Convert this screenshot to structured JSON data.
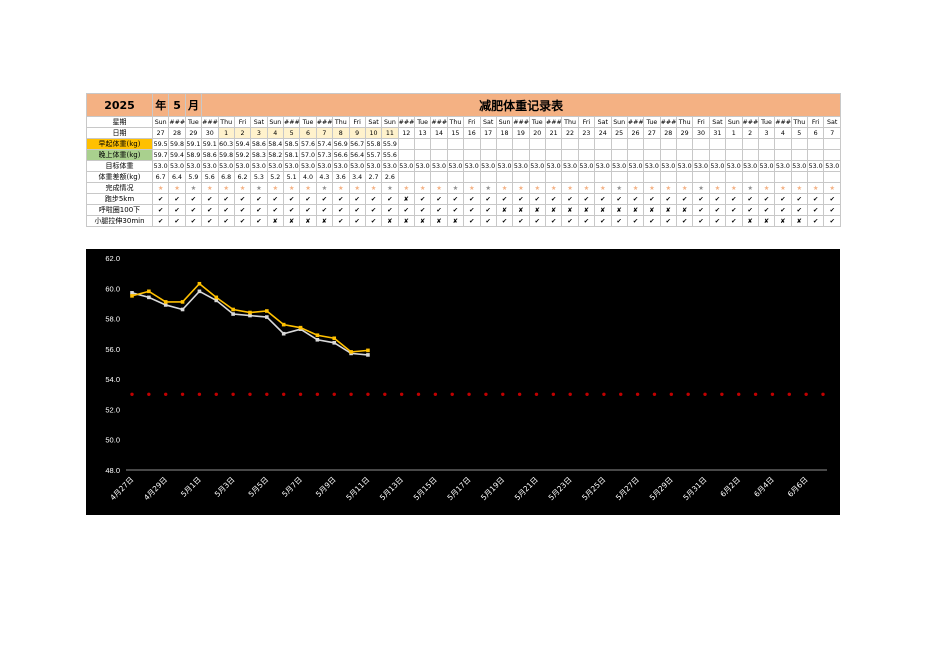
{
  "header": {
    "year": "2025",
    "year_unit": "年",
    "month": "5",
    "month_unit": "月",
    "title": "减肥体重记录表"
  },
  "rows": {
    "weekday_label": "星期",
    "date_label": "日期",
    "morning_label": "早起体重(kg)",
    "evening_label": "晚上体重(kg)",
    "target_label": "目标体重",
    "gap_label": "体重差额(kg)",
    "status_label": "完成情况",
    "run_label": "跑步5km",
    "squat_label": "呼啦圈100下",
    "stretch_label": "小腿拉伸30min"
  },
  "weekdays": [
    "Sun",
    "###",
    "Tue",
    "###",
    "Thu",
    "Fri",
    "Sat",
    "Sun",
    "###",
    "Tue",
    "###",
    "Thu",
    "Fri",
    "Sat",
    "Sun",
    "###",
    "Tue",
    "###",
    "Thu",
    "Fri",
    "Sat",
    "Sun",
    "###",
    "Tue",
    "###",
    "Thu",
    "Fri",
    "Sat",
    "Sun",
    "###",
    "Tue",
    "###",
    "Thu",
    "Fri",
    "Sat",
    "Sun",
    "###",
    "Tue",
    "###",
    "Thu",
    "Fri",
    "Sat"
  ],
  "dates": [
    "27",
    "28",
    "29",
    "30",
    "1",
    "2",
    "3",
    "4",
    "5",
    "6",
    "7",
    "8",
    "9",
    "10",
    "11",
    "12",
    "13",
    "14",
    "15",
    "16",
    "17",
    "18",
    "19",
    "20",
    "21",
    "22",
    "23",
    "24",
    "25",
    "26",
    "27",
    "28",
    "29",
    "30",
    "31",
    "1",
    "2",
    "3",
    "4",
    "5",
    "6",
    "7"
  ],
  "morning": [
    "59.5",
    "59.8",
    "59.1",
    "59.1",
    "60.3",
    "59.4",
    "58.6",
    "58.4",
    "58.5",
    "57.6",
    "57.4",
    "56.9",
    "56.7",
    "55.8",
    "55.9",
    "",
    "",
    "",
    "",
    "",
    "",
    "",
    "",
    "",
    "",
    "",
    "",
    "",
    "",
    "",
    "",
    "",
    "",
    "",
    "",
    "",
    "",
    "",
    "",
    "",
    "",
    ""
  ],
  "evening": [
    "59.7",
    "59.4",
    "58.9",
    "58.6",
    "59.8",
    "59.2",
    "58.3",
    "58.2",
    "58.1",
    "57.0",
    "57.3",
    "56.6",
    "56.4",
    "55.7",
    "55.6",
    "",
    "",
    "",
    "",
    "",
    "",
    "",
    "",
    "",
    "",
    "",
    "",
    "",
    "",
    "",
    "",
    "",
    "",
    "",
    "",
    "",
    "",
    "",
    "",
    "",
    "",
    ""
  ],
  "target": [
    "53.0",
    "53.0",
    "53.0",
    "53.0",
    "53.0",
    "53.0",
    "53.0",
    "53.0",
    "53.0",
    "53.0",
    "53.0",
    "53.0",
    "53.0",
    "53.0",
    "53.0",
    "53.0",
    "53.0",
    "53.0",
    "53.0",
    "53.0",
    "53.0",
    "53.0",
    "53.0",
    "53.0",
    "53.0",
    "53.0",
    "53.0",
    "53.0",
    "53.0",
    "53.0",
    "53.0",
    "53.0",
    "53.0",
    "53.0",
    "53.0",
    "53.0",
    "53.0",
    "53.0",
    "53.0",
    "53.0",
    "53.0",
    "53.0"
  ],
  "gap": [
    "6.7",
    "6.4",
    "5.9",
    "5.6",
    "6.8",
    "6.2",
    "5.3",
    "5.2",
    "5.1",
    "4.0",
    "4.3",
    "3.6",
    "3.4",
    "2.7",
    "2.6",
    "",
    "",
    "",
    "",
    "",
    "",
    "",
    "",
    "",
    "",
    "",
    "",
    "",
    "",
    "",
    "",
    "",
    "",
    "",
    "",
    "",
    "",
    "",
    "",
    "",
    "",
    ""
  ],
  "status_stars": [
    "g",
    "g",
    "s",
    "g",
    "g",
    "g",
    "s",
    "g",
    "g",
    "g",
    "s",
    "g",
    "g",
    "g",
    "s",
    "g",
    "g",
    "g",
    "s",
    "g",
    "s",
    "g",
    "g",
    "g",
    "g",
    "g",
    "g",
    "g",
    "s",
    "g",
    "g",
    "g",
    "g",
    "s",
    "g",
    "g",
    "s",
    "g",
    "g",
    "g",
    "g",
    "g"
  ],
  "run": [
    "✔",
    "✔",
    "✔",
    "✔",
    "✔",
    "✔",
    "✔",
    "✔",
    "✔",
    "✔",
    "✔",
    "✔",
    "✔",
    "✔",
    "✔",
    "✘",
    "✔",
    "✔",
    "✔",
    "✔",
    "✔",
    "✔",
    "✔",
    "✔",
    "✔",
    "✔",
    "✔",
    "✔",
    "✔",
    "✔",
    "✔",
    "✔",
    "✔",
    "✔",
    "✔",
    "✔",
    "✔",
    "✔",
    "✔",
    "✔",
    "✔",
    "✔"
  ],
  "squat": [
    "✔",
    "✔",
    "✔",
    "✔",
    "✔",
    "✔",
    "✔",
    "✔",
    "✔",
    "✔",
    "✔",
    "✔",
    "✔",
    "✔",
    "✔",
    "✔",
    "✔",
    "✔",
    "✔",
    "✔",
    "✔",
    "✘",
    "✘",
    "✘",
    "✘",
    "✘",
    "✘",
    "✘",
    "✘",
    "✘",
    "✘",
    "✘",
    "✘",
    "✔",
    "✔",
    "✔",
    "✔",
    "✔",
    "✔",
    "✔",
    "✔",
    "✔"
  ],
  "stretch": [
    "✔",
    "✔",
    "✔",
    "✔",
    "✔",
    "✔",
    "✔",
    "✘",
    "✘",
    "✘",
    "✘",
    "✔",
    "✔",
    "✔",
    "✘",
    "✘",
    "✘",
    "✘",
    "✘",
    "✔",
    "✔",
    "✔",
    "✔",
    "✔",
    "✔",
    "✔",
    "✔",
    "✔",
    "✔",
    "✔",
    "✔",
    "✔",
    "✔",
    "✔",
    "✔",
    "✔",
    "✘",
    "✘",
    "✘",
    "✘",
    "✔",
    "✔"
  ],
  "colors": {
    "header_fill": "#f4b183",
    "morning_fill": "#ffc000",
    "evening_fill": "#a9d08e",
    "chart_bg": "#000000",
    "line_morning": "#ffc000",
    "line_evening": "#d9d9d9",
    "line_target": "#c00000"
  },
  "chart_data": {
    "type": "line",
    "title": "",
    "xlabel": "",
    "ylabel": "",
    "ylim": [
      48,
      62
    ],
    "yticks": [
      "48.0",
      "50.0",
      "52.0",
      "54.0",
      "56.0",
      "58.0",
      "60.0",
      "62.0"
    ],
    "xtick_labels": [
      "4月27日",
      "4月29日",
      "5月1日",
      "5月3日",
      "5月5日",
      "5月7日",
      "5月9日",
      "5月11日",
      "5月13日",
      "5月15日",
      "5月17日",
      "5月19日",
      "5月21日",
      "5月23日",
      "5月25日",
      "5月27日",
      "5月29日",
      "5月31日",
      "6月2日",
      "6月4日",
      "6月6日"
    ],
    "grid": false,
    "legend": "none",
    "series": [
      {
        "values": [
          59.5,
          59.8,
          59.1,
          59.1,
          60.3,
          59.4,
          58.6,
          58.4,
          58.5,
          57.6,
          57.4,
          56.9,
          56.7,
          55.8,
          55.9
        ]
      },
      {
        "values": [
          59.7,
          59.4,
          58.9,
          58.6,
          59.8,
          59.2,
          58.3,
          58.2,
          58.1,
          57.0,
          57.3,
          56.6,
          56.4,
          55.7,
          55.6
        ]
      },
      {
        "values": [
          53,
          53,
          53,
          53,
          53,
          53,
          53,
          53,
          53,
          53,
          53,
          53,
          53,
          53,
          53,
          53,
          53,
          53,
          53,
          53,
          53,
          53,
          53,
          53,
          53,
          53,
          53,
          53,
          53,
          53,
          53,
          53,
          53,
          53,
          53,
          53,
          53,
          53,
          53,
          53,
          53,
          53
        ]
      }
    ]
  }
}
